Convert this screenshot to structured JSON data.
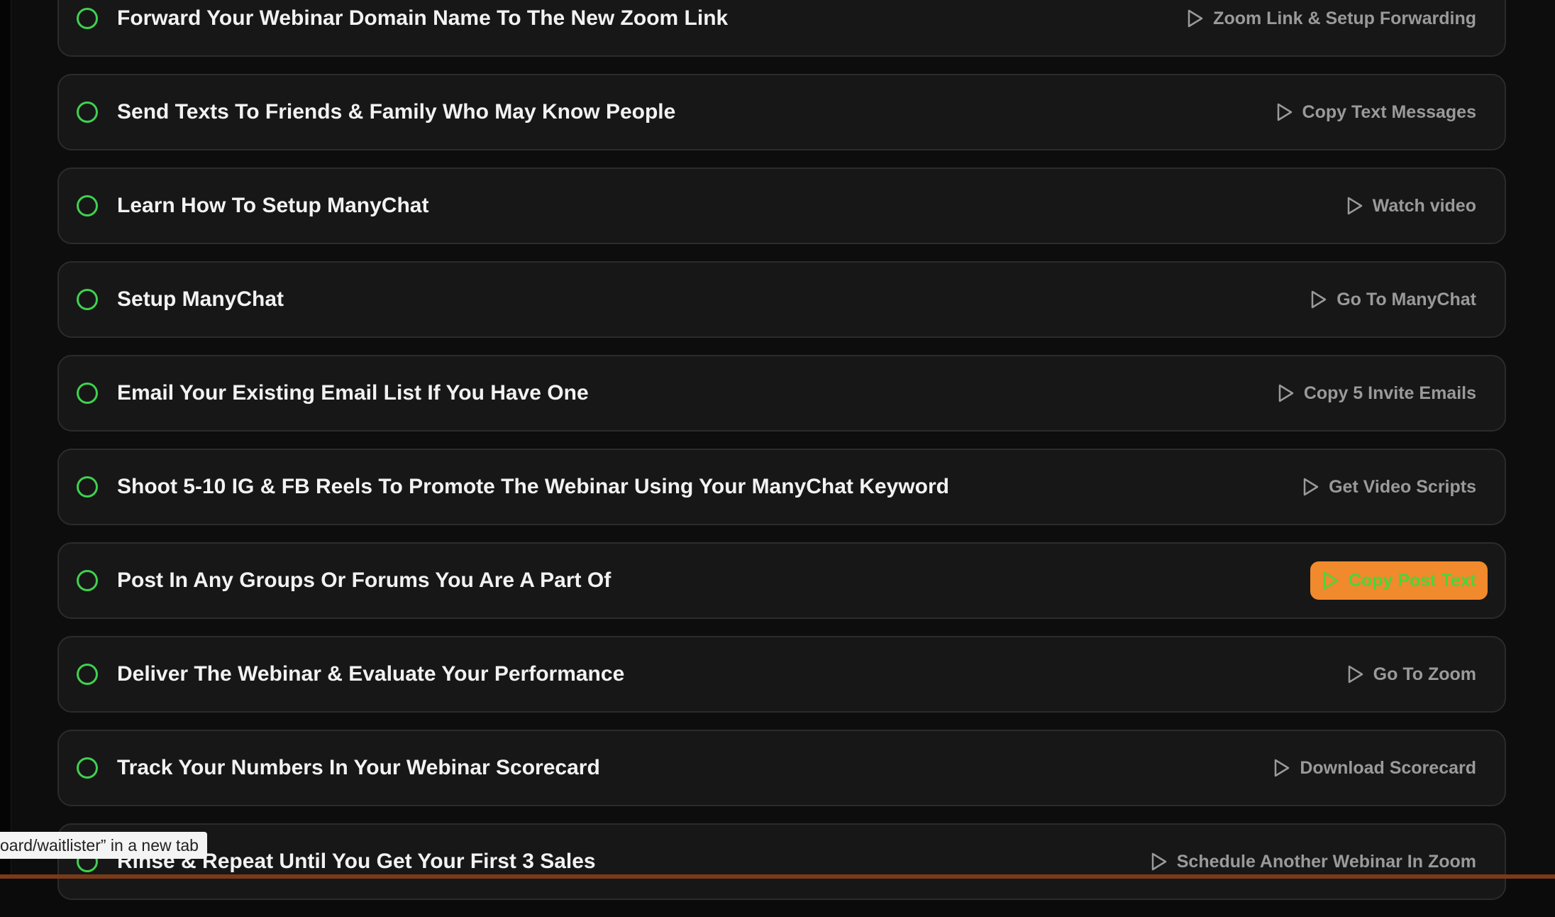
{
  "tasks": [
    {
      "title": "Forward Your Webinar Domain Name To The New Zoom Link",
      "action": "Zoom Link & Setup Forwarding",
      "action_icon": "play-icon"
    },
    {
      "title": "Send Texts To Friends & Family Who May Know People",
      "action": "Copy Text Messages",
      "action_icon": "play-icon"
    },
    {
      "title": "Learn How To Setup ManyChat",
      "action": "Watch video",
      "action_icon": "play-icon"
    },
    {
      "title": "Setup ManyChat",
      "action": "Go To ManyChat",
      "action_icon": "play-icon"
    },
    {
      "title": "Email Your Existing Email List If You Have One",
      "action": "Copy 5 Invite Emails",
      "action_icon": "play-icon"
    },
    {
      "title": "Shoot 5-10 IG & FB Reels To Promote The Webinar Using Your ManyChat Keyword",
      "action": "Get Video Scripts",
      "action_icon": "play-icon"
    },
    {
      "title": "Post In Any Groups Or Forums You Are A Part Of",
      "action": "Copy Post Text",
      "action_icon": "play-icon",
      "hovered": true
    },
    {
      "title": "Deliver The Webinar & Evaluate Your Performance",
      "action": "Go To Zoom",
      "action_icon": "play-icon"
    },
    {
      "title": "Track Your Numbers In Your Webinar Scorecard",
      "action": "Download Scorecard",
      "action_icon": "play-icon"
    },
    {
      "title": "Rinse & Repeat Until You Get Your First 3 Sales",
      "action": "Schedule Another Webinar In Zoom",
      "action_icon": "play-icon"
    }
  ],
  "tooltip": {
    "text": "oard/waitlister” in a new tab"
  },
  "colors": {
    "check_ring": "#3fd14f",
    "active_button_bg": "#f08a2c",
    "active_button_text": "#4cd43c"
  }
}
